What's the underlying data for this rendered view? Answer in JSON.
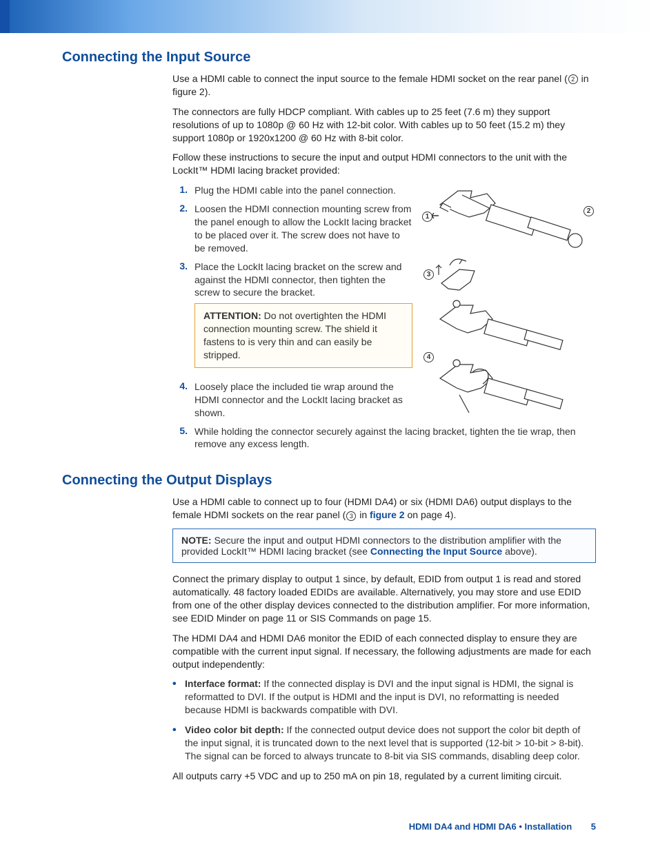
{
  "section1": {
    "heading": "Connecting the Input Source",
    "p1_a": "Use a HDMI cable to connect the input source to the female HDMI socket on the rear panel (",
    "p1_b": " in figure 2).",
    "p2": "The connectors are fully HDCP compliant. With cables up to 25 feet (7.6 m) they support resolutions of up to 1080p @ 60 Hz with 12-bit color. With cables up to 50 feet (15.2 m) they support 1080p or 1920x1200 @ 60 Hz with 8-bit color.",
    "p3": "Follow these instructions to secure the input and output HDMI connectors to the unit with the LockIt™ HDMI lacing bracket provided:",
    "steps": {
      "s1": "Plug the HDMI cable into the panel connection.",
      "s2": "Loosen the HDMI connection mounting screw from the panel enough to allow the LockIt lacing bracket to be placed over it. The screw does not have to be removed.",
      "s3": "Place the LockIt lacing bracket on the screw and against the HDMI connector, then tighten the screw to secure the bracket.",
      "s4": "Loosely place the included tie wrap around the HDMI connector and the LockIt lacing bracket as shown.",
      "s5": "While holding the connector securely against the lacing bracket, tighten the tie wrap, then remove any excess length."
    },
    "attention_label": "ATTENTION:",
    "attention_text": "Do not overtighten the HDMI connection mounting screw. The shield it fastens to is very thin and can easily be stripped."
  },
  "section2": {
    "heading": "Connecting the Output Displays",
    "p1_a": "Use a HDMI cable to connect up to four (HDMI DA4) or six (HDMI DA6) output displays to the female HDMI sockets on the rear panel (",
    "p1_b": " in ",
    "p1_link": "figure 2",
    "p1_c": " on page 4).",
    "note_label": "NOTE:",
    "note_a": "Secure the input and output HDMI connectors to the distribution amplifier with the provided LockIt™ HDMI lacing bracket (see ",
    "note_link": "Connecting the Input Source",
    "note_b": " above).",
    "p2": "Connect the primary display to output 1 since, by default, EDID from output 1 is read and stored automatically. 48 factory loaded EDIDs are available. Alternatively, you may store and use EDID from one of the other display devices connected to the distribution amplifier. For more information, see EDID Minder on page 11 or SIS Commands on page 15.",
    "p3": "The HDMI DA4 and HDMI DA6 monitor the EDID of each connected display to ensure they are compatible with the current input signal. If necessary, the following adjustments are made for each output independently:",
    "bullets": {
      "b1_label": "Interface format:",
      "b1_text": " If the connected display is DVI and the input signal is HDMI, the signal is reformatted to DVI. If the output is HDMI and the input is DVI, no reformatting is needed because HDMI is backwards compatible with DVI.",
      "b2_label": "Video color bit depth:",
      "b2_text": " If the connected output device does not support the color bit depth of the input signal, it is truncated down to the next level that is supported (12-bit > 10-bit > 8-bit). The signal can be forced to always truncate to 8-bit via SIS commands, disabling deep color."
    },
    "p4": "All outputs carry +5 VDC and up to 250 mA on pin 18, regulated by a current limiting circuit."
  },
  "footer": {
    "label": "HDMI DA4 and HDMI DA6 • Installation",
    "page": "5"
  },
  "circled_nums": {
    "n2": "2",
    "n3": "3"
  },
  "fig_callouts": {
    "c1": "1",
    "c2": "2",
    "c3": "3",
    "c4": "4"
  }
}
